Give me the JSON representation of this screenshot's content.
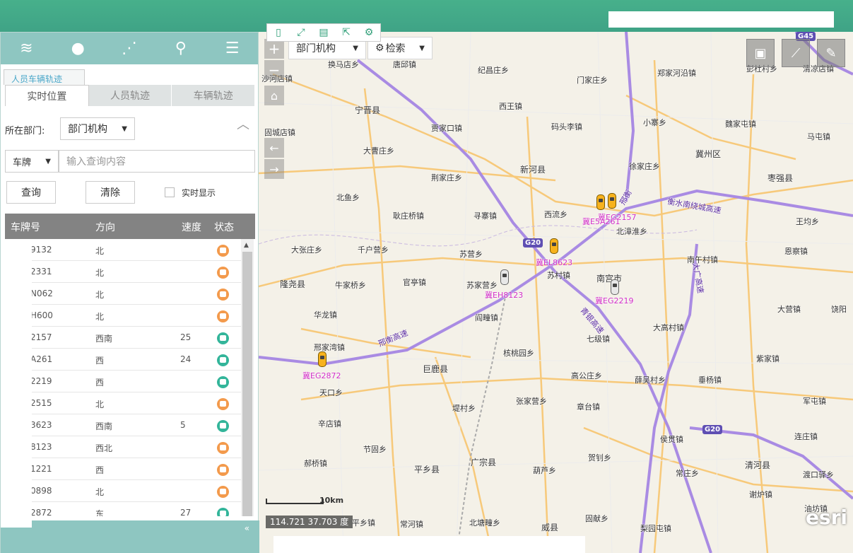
{
  "panel": {
    "tab_label": "人员车辆轨迹",
    "subtabs": [
      "实时位置",
      "人员轨迹",
      "车辆轨迹"
    ],
    "dept_label": "所在部门:",
    "dept_value": "部门机构",
    "plate_select": "车牌",
    "search_placeholder": "输入查询内容",
    "query_button": "查询",
    "clear_button": "清除",
    "realtime_label": "实时显示",
    "columns": [
      "车牌号",
      "方向",
      "速度",
      "状态"
    ],
    "rows": [
      {
        "plate": "9132",
        "dir": "北",
        "speed": "",
        "status": "orange"
      },
      {
        "plate": "2331",
        "dir": "北",
        "speed": "",
        "status": "orange"
      },
      {
        "plate": "N062",
        "dir": "北",
        "speed": "",
        "status": "orange"
      },
      {
        "plate": "H600",
        "dir": "北",
        "speed": "",
        "status": "orange"
      },
      {
        "plate": "2157",
        "dir": "西南",
        "speed": "25",
        "status": "green"
      },
      {
        "plate": "A261",
        "dir": "西",
        "speed": "24",
        "status": "green"
      },
      {
        "plate": "2219",
        "dir": "西",
        "speed": "",
        "status": "green"
      },
      {
        "plate": "2515",
        "dir": "北",
        "speed": "",
        "status": "orange"
      },
      {
        "plate": "3623",
        "dir": "西南",
        "speed": "5",
        "status": "green"
      },
      {
        "plate": "8123",
        "dir": "西北",
        "speed": "",
        "status": "orange"
      },
      {
        "plate": "1221",
        "dir": "西",
        "speed": "",
        "status": "orange"
      },
      {
        "plate": "0898",
        "dir": "北",
        "speed": "",
        "status": "orange"
      },
      {
        "plate": "2872",
        "dir": "东",
        "speed": "27",
        "status": "green"
      }
    ],
    "collapse_arrow": "«"
  },
  "map": {
    "dept_select": "部门机构",
    "search_select": "检索",
    "scale": "10km",
    "coords": "114.721 37.703 度",
    "esri": "esri",
    "shields": [
      {
        "text": "G20"
      },
      {
        "text": "G20"
      },
      {
        "text": "G45"
      }
    ],
    "road_labels": [
      "衡水南绕城高速",
      "邢衡高速",
      "青银高速",
      "大广高速",
      "邢衡"
    ],
    "places": [
      "换马店乡",
      "唐邱镇",
      "纪昌庄乡",
      "门家庄乡",
      "郑家河沿镇",
      "彭杜村乡",
      "清凉店镇",
      "宁晋县",
      "西王镇",
      "小寨乡",
      "魏家屯镇",
      "马屯镇",
      "贾家口镇",
      "码头李镇",
      "冀州区",
      "固城店镇",
      "大曹庄乡",
      "新河县",
      "徐家庄乡",
      "枣强县",
      "荆家庄乡",
      "北鱼乡",
      "寻寨镇",
      "西流乡",
      "北漳淮乡",
      "王均乡",
      "耿庄桥镇",
      "大张庄乡",
      "千户营乡",
      "苏营乡",
      "南午村镇",
      "恩察镇",
      "隆尧县",
      "牛家桥乡",
      "官亭镇",
      "苏家营乡",
      "苏村镇",
      "南宫市",
      "大营镇",
      "华龙镇",
      "阎疃镇",
      "大高村镇",
      "邢家湾镇",
      "七级镇",
      "核桃园乡",
      "巨鹿县",
      "紫家镇",
      "高公庄乡",
      "薛吴村乡",
      "垂杨镇",
      "天口乡",
      "张家营乡",
      "堤村乡",
      "章台镇",
      "军屯镇",
      "辛店镇",
      "侯贯镇",
      "连庄镇",
      "节固乡",
      "贺钊乡",
      "郝桥镇",
      "广宗县",
      "平乡县",
      "葫芦乡",
      "常庄乡",
      "清河县",
      "渡口驿乡",
      "谢炉镇",
      "油坊镇",
      "平乡镇",
      "常河镇",
      "北塘疃乡",
      "威县",
      "固献乡",
      "梨园屯镇",
      "沙河店镇",
      "饶阳"
    ],
    "vehicles": [
      {
        "plate": "冀EG2157"
      },
      {
        "plate": "冀E5A261"
      },
      {
        "plate": "冀EL8623"
      },
      {
        "plate": "冀EH8123"
      },
      {
        "plate": "冀EG2219"
      },
      {
        "plate": "冀EG2872"
      }
    ]
  },
  "colors": {
    "topbar": "#47b08b",
    "panel_teal": "#8ec6c1",
    "status_orange": "#f39a4c",
    "status_green": "#33b59a",
    "highway": "#a186e0",
    "road": "#f7c36a",
    "plate_text": "#d12ec6"
  }
}
